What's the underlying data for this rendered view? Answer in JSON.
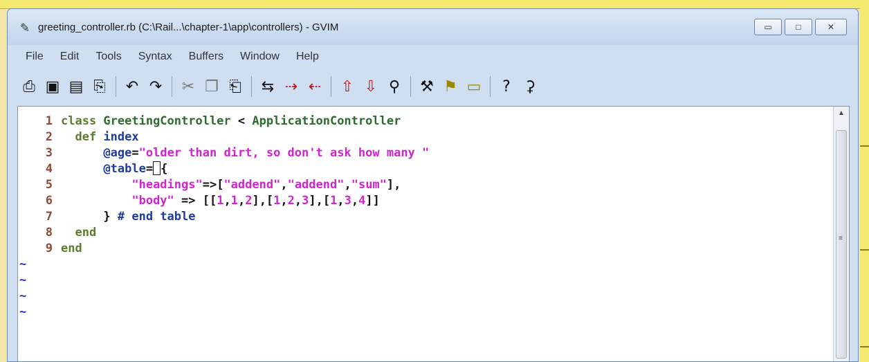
{
  "window": {
    "title": "greeting_controller.rb (C:\\Rail...\\chapter-1\\app\\controllers) - GVIM",
    "app_icon": "vim-icon",
    "controls": {
      "minimize_icon": "minimize-icon",
      "maximize_icon": "maximize-icon",
      "close_icon": "close-icon"
    }
  },
  "menu": [
    "File",
    "Edit",
    "Tools",
    "Syntax",
    "Buffers",
    "Window",
    "Help"
  ],
  "toolbar": {
    "icons": [
      "open-icon",
      "save-icon",
      "save-all-icon",
      "print-icon",
      "undo-icon",
      "redo-icon",
      "cut-icon",
      "copy-icon",
      "paste-icon",
      "replace-icon",
      "find-next-icon",
      "find-prev-icon",
      "load-session-icon",
      "save-session-icon",
      "run-script-icon",
      "make-icon",
      "ctags-icon",
      "tag-jump-icon",
      "help-icon",
      "find-help-icon"
    ]
  },
  "editor": {
    "line_numbers": [
      "1",
      "2",
      "3",
      "4",
      "5",
      "6",
      "7",
      "8",
      "9"
    ],
    "lines": [
      {
        "kw": "class ",
        "cls": "GreetingController",
        "op": " < ",
        "cls2": "ApplicationController"
      },
      {
        "indent": "  ",
        "kw": "def ",
        "name": "index"
      },
      {
        "indent": "      ",
        "ivar": "@age",
        "op": "=",
        "str": "\"older than dirt, so don't ask how many \""
      },
      {
        "indent": "      ",
        "ivar": "@table",
        "op": "=",
        "rest": "{"
      },
      {
        "indent": "          ",
        "s1": "\"headings\"",
        "op": "=>[",
        "s2": "\"addend\"",
        "c1": ",",
        "s3": "\"addend\"",
        "c2": ",",
        "s4": "\"sum\"",
        "end": "],"
      },
      {
        "indent": "          ",
        "s1": "\"body\"",
        "op": " => [[",
        "n1": "1",
        "c1": ",",
        "n2": "1",
        "c2": ",",
        "n3": "2",
        "b1": "],[",
        "n4": "1",
        "c3": ",",
        "n5": "2",
        "c4": ",",
        "n6": "3",
        "b2": "],[",
        "n7": "1",
        "c5": ",",
        "n8": "3",
        "c6": ",",
        "n9": "4",
        "end": "]]"
      },
      {
        "indent": "      ",
        "p": "} ",
        "comment": "# end table"
      },
      {
        "indent": "  ",
        "kw": "end"
      },
      {
        "kw": "end"
      }
    ],
    "tildes": [
      "~",
      "~",
      "~",
      "~"
    ]
  }
}
